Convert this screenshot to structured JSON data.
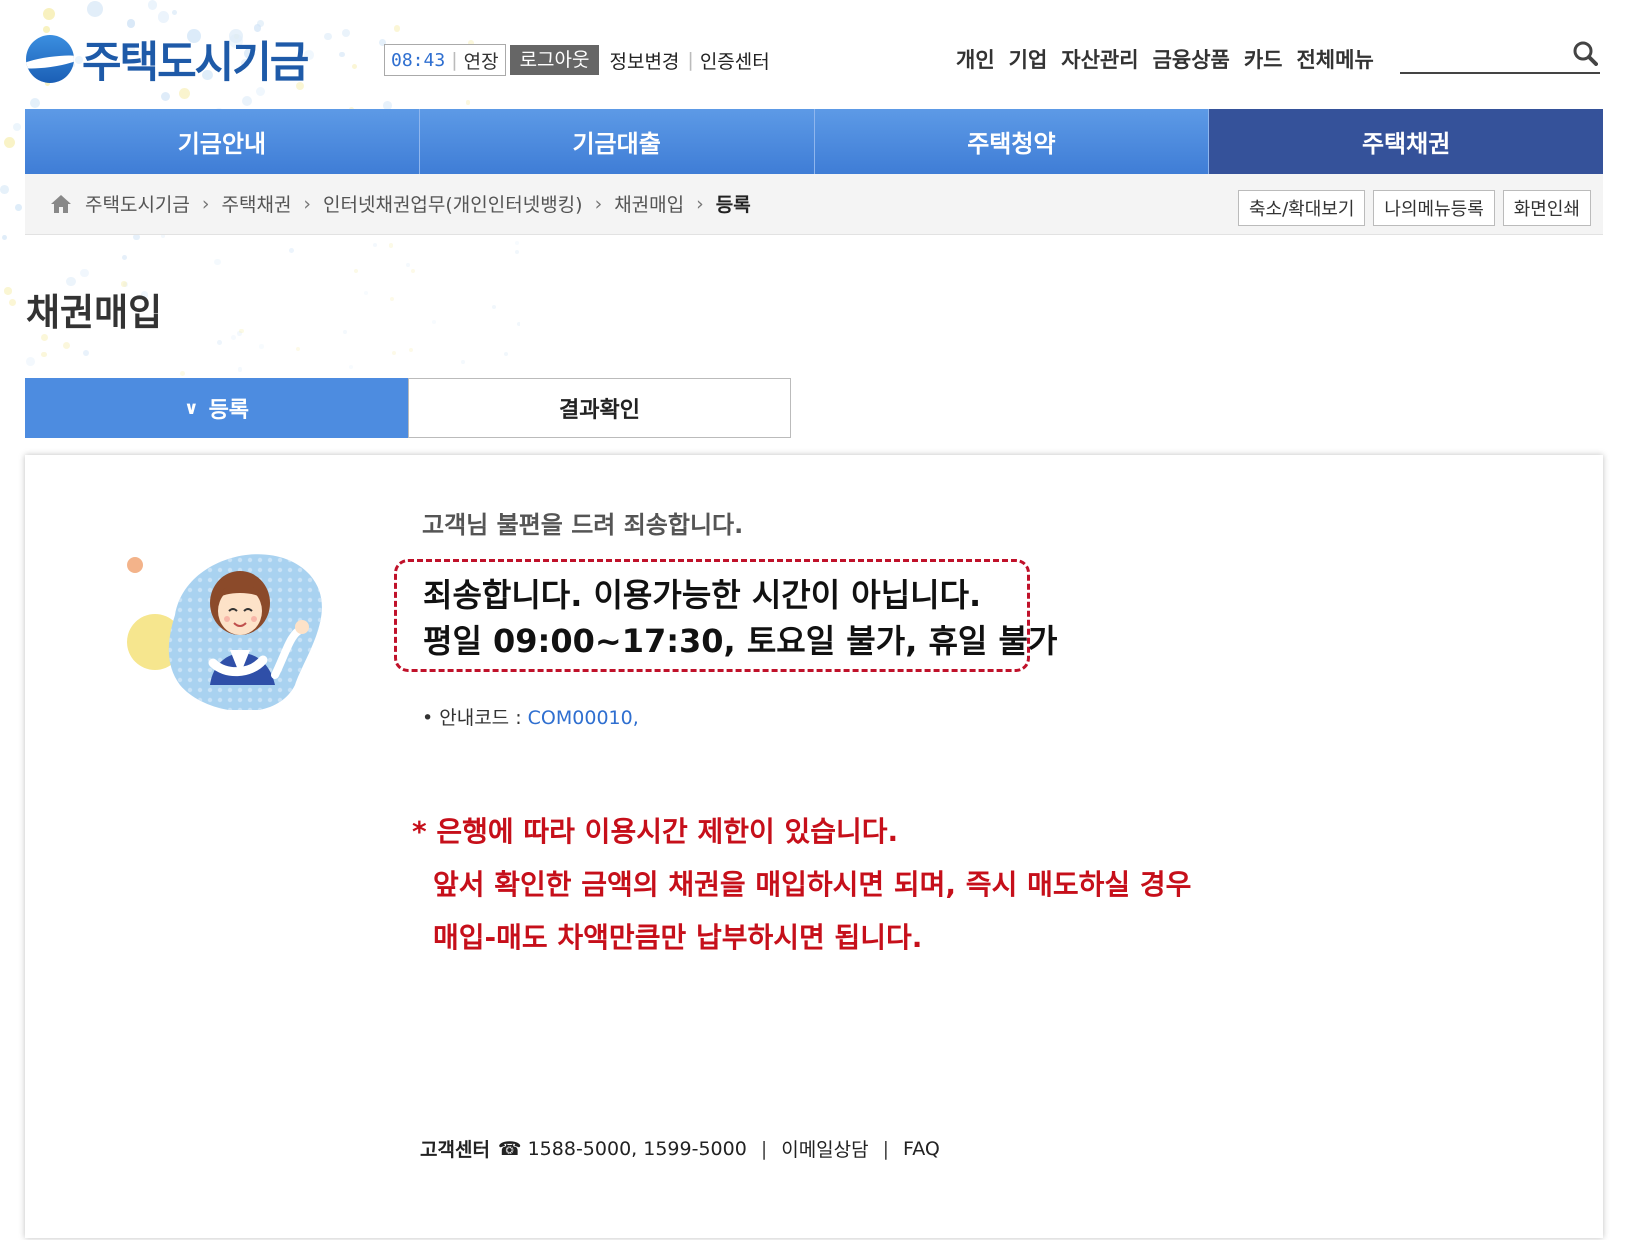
{
  "brand": {
    "name": "주택도시기금"
  },
  "session": {
    "time": "08:43",
    "extend": "연장",
    "logout": "로그아웃",
    "info_change": "정보변경",
    "cert_center": "인증센터"
  },
  "util_menu": [
    "개인",
    "기업",
    "자산관리",
    "금융상품",
    "카드",
    "전체메뉴"
  ],
  "search": {
    "placeholder": ""
  },
  "nav": [
    "기금안내",
    "기금대출",
    "주택청약",
    "주택채권"
  ],
  "breadcrumb": [
    "주택도시기금",
    "주택채권",
    "인터넷채권업무(개인인터넷뱅킹)",
    "채권매입",
    "등록"
  ],
  "util_buttons": [
    "축소/확대보기",
    "나의메뉴등록",
    "화면인쇄"
  ],
  "page_title": "채권매입",
  "tabs": [
    "등록",
    "결과확인"
  ],
  "message": {
    "heading": "고객님 불편을 드려 죄송합니다.",
    "line1": "죄송합니다. 이용가능한 시간이 아닙니다.",
    "line2": "평일 09:00~17:30, 토요일 불가, 휴일 불가",
    "guide_label": "• 안내코드 : ",
    "guide_code": "COM00010,"
  },
  "note": {
    "line1": "* 은행에 따라 이용시간 제한이 있습니다.",
    "line2": "앞서 확인한 금액의 채권을 매입하시면 되며, 즉시 매도하실 경우",
    "line3": "매입-매도 차액만큼만 납부하시면 됩니다."
  },
  "footer": {
    "title": "고객센터",
    "phone_icon": "☎",
    "phones": "1588-5000, 1599-5000",
    "email": "이메일상담",
    "faq": "FAQ"
  },
  "colors": {
    "nav_blue": "#4d8ce0",
    "nav_active": "#35529a",
    "alert_red": "#c60f1a",
    "link_blue": "#2f6fd0"
  }
}
